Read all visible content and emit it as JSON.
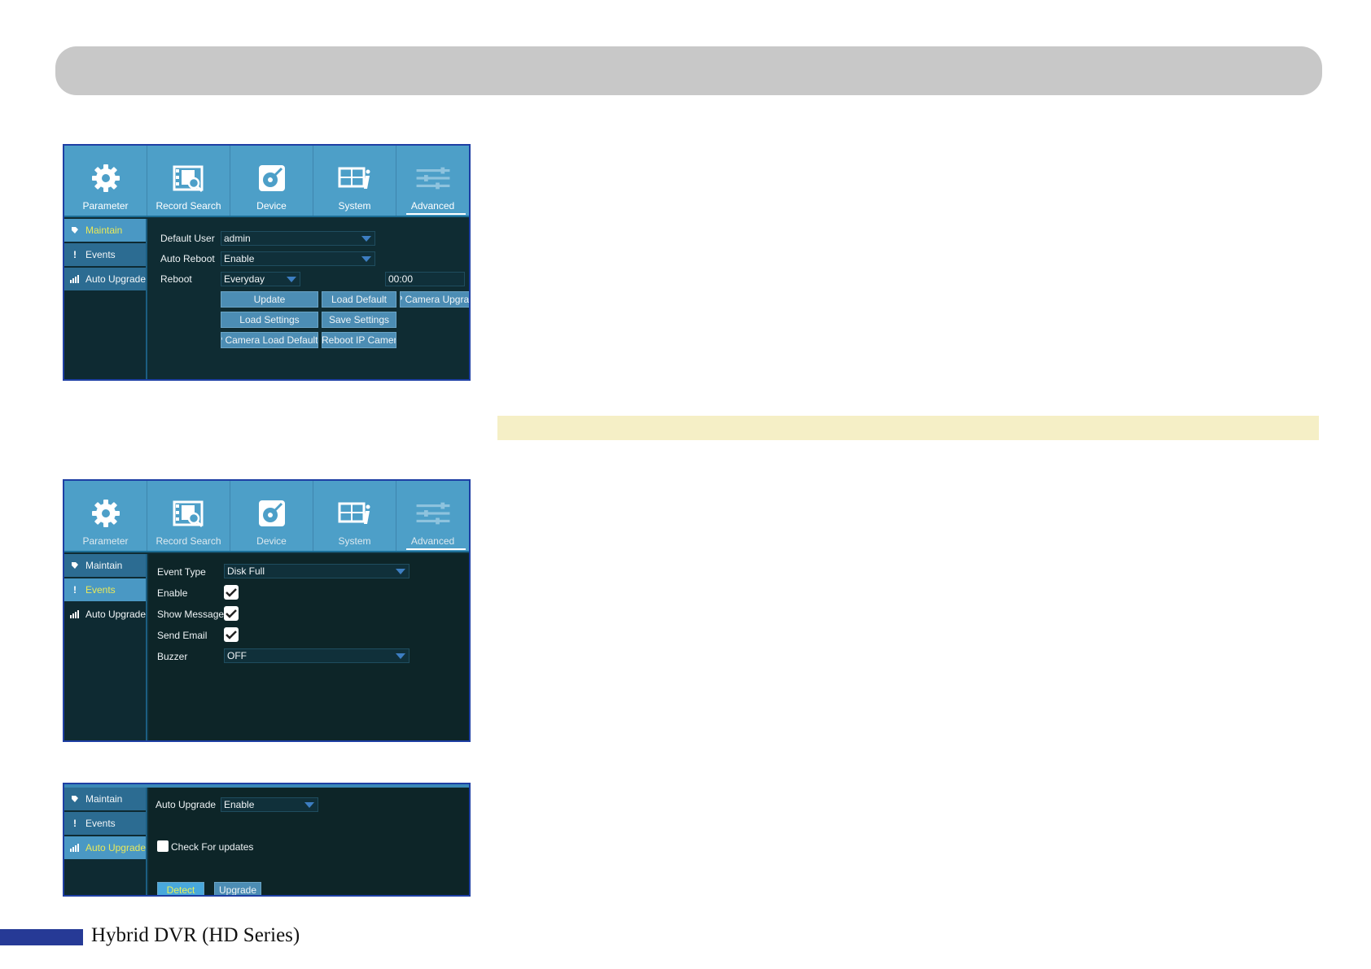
{
  "tabs": [
    {
      "label": "Parameter",
      "icon": "gear-icon"
    },
    {
      "label": "Record Search",
      "icon": "film-search-icon"
    },
    {
      "label": "Device",
      "icon": "disk-icon"
    },
    {
      "label": "System",
      "icon": "system-info-icon"
    },
    {
      "label": "Advanced",
      "icon": "sliders-icon"
    }
  ],
  "sidebar": [
    {
      "label": "Maintain",
      "icon": "maintain-icon"
    },
    {
      "label": "Events",
      "icon": "exclamation-icon"
    },
    {
      "label": "Auto Upgrade",
      "icon": "upgrade-bars-icon"
    }
  ],
  "maintain": {
    "default_user_label": "Default User",
    "default_user_value": "admin",
    "auto_reboot_label": "Auto Reboot",
    "auto_reboot_value": "Enable",
    "reboot_label": "Reboot",
    "reboot_value": "Everyday",
    "reboot_time": "00:00",
    "buttons": {
      "update": "Update",
      "load_default": "Load Default",
      "ip_camera_upgrade": "IP Camera Upgrade",
      "load_settings": "Load Settings",
      "save_settings": "Save Settings",
      "ip_camera_load_default": "IP Camera Load Default",
      "reboot_ip_camera": "Reboot IP Camera"
    }
  },
  "events": {
    "event_type_label": "Event Type",
    "event_type_value": "Disk Full",
    "enable_label": "Enable",
    "enable_checked": true,
    "show_message_label": "Show Message",
    "show_message_checked": true,
    "send_email_label": "Send Email",
    "send_email_checked": true,
    "buzzer_label": "Buzzer",
    "buzzer_value": "OFF"
  },
  "auto_upgrade": {
    "auto_upgrade_label": "Auto Upgrade",
    "auto_upgrade_value": "Enable",
    "check_updates_label": "Check For updates",
    "check_updates_checked": false,
    "detect_label": "Detect",
    "upgrade_label": "Upgrade"
  },
  "footer": {
    "title": "Hybrid DVR (HD Series)"
  },
  "colors": {
    "panel_border": "#1e3fa4",
    "tab_bar": "#4d9fc8",
    "sidebar_item": "#2c6c92",
    "active_text": "#e8e85a",
    "footer_block": "#263a96",
    "note_bar": "#f5efc6"
  }
}
